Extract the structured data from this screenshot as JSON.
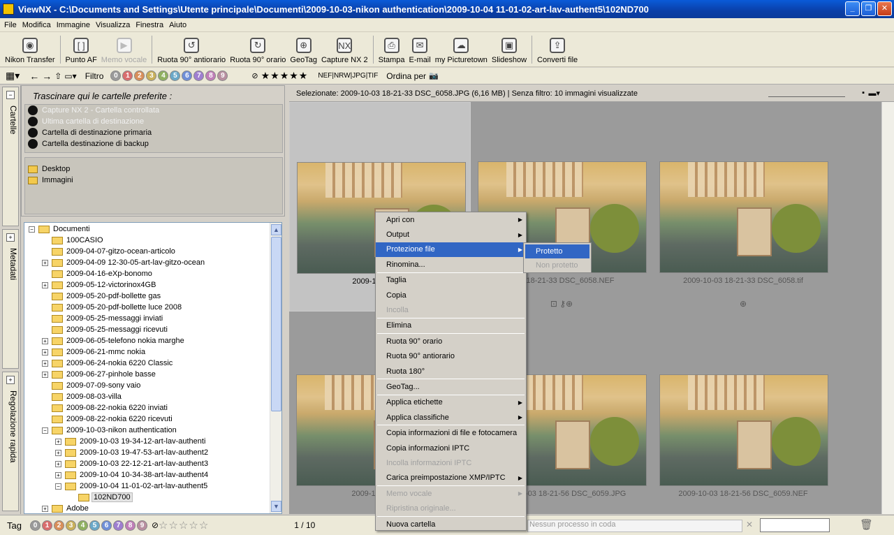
{
  "window": {
    "title": "ViewNX - C:\\Documents and Settings\\Utente principale\\Documenti\\2009-10-03-nikon authentication\\2009-10-04 11-01-02-art-lav-authent5\\102ND700"
  },
  "menu": [
    "File",
    "Modifica",
    "Immagine",
    "Visualizza",
    "Finestra",
    "Aiuto"
  ],
  "toolbar": [
    {
      "label": "Nikon Transfer",
      "icon": "camera-icon",
      "enabled": true
    },
    {
      "label": "Punto AF",
      "icon": "af-point-icon",
      "enabled": true
    },
    {
      "label": "Memo vocale",
      "icon": "voice-memo-icon",
      "enabled": false
    },
    {
      "label": "Ruota 90° antiorario",
      "icon": "rotate-ccw-icon",
      "enabled": true
    },
    {
      "label": "Ruota 90° orario",
      "icon": "rotate-cw-icon",
      "enabled": true
    },
    {
      "label": "GeoTag",
      "icon": "globe-icon",
      "enabled": true
    },
    {
      "label": "Capture NX 2",
      "icon": "capture-nx-icon",
      "enabled": true
    },
    {
      "label": "Stampa",
      "icon": "printer-icon",
      "enabled": true
    },
    {
      "label": "E-mail",
      "icon": "mail-icon",
      "enabled": true
    },
    {
      "label": "my Picturetown",
      "icon": "picturetown-icon",
      "enabled": true
    },
    {
      "label": "Slideshow",
      "icon": "slideshow-icon",
      "enabled": true
    },
    {
      "label": "Converti file",
      "icon": "convert-icon",
      "enabled": true
    }
  ],
  "filterbar": {
    "filter_label": "Filtro",
    "labels": [
      "0",
      "1",
      "2",
      "3",
      "4",
      "5",
      "6",
      "7",
      "8",
      "9"
    ],
    "label_colors": [
      "#9a9a9a",
      "#d96d6d",
      "#d98f5a",
      "#c9b05a",
      "#8fb060",
      "#6aa8c8",
      "#6f8fd8",
      "#9f7fd0",
      "#c07fb8",
      "#b88fa0"
    ],
    "stars": "★★★★★",
    "formats": "NEF|NRW|JPG|TIF",
    "sort_label": "Ordina per"
  },
  "side_tabs": [
    "Cartelle",
    "Metadati",
    "Regolazione rapida"
  ],
  "favorites": {
    "hint": "Trascinare qui le cartelle preferite :",
    "special": [
      {
        "label": "Capture NX 2 - Cartella controllata",
        "enabled": false
      },
      {
        "label": "Ultima cartella di destinazione",
        "enabled": false
      },
      {
        "label": "Cartella di destinazione primaria",
        "enabled": true
      },
      {
        "label": "Cartella destinazione di backup",
        "enabled": true
      }
    ],
    "folders": [
      "Desktop",
      "Immagini"
    ]
  },
  "tree": [
    {
      "label": "Documenti",
      "level": 0,
      "exp": "-"
    },
    {
      "label": "100CASIO",
      "level": 1,
      "exp": ""
    },
    {
      "label": "2009-04-07-gitzo-ocean-articolo",
      "level": 1,
      "exp": ""
    },
    {
      "label": "2009-04-09 12-30-05-art-lav-gitzo-ocean",
      "level": 1,
      "exp": "+"
    },
    {
      "label": "2009-04-16-eXp-bonomo",
      "level": 1,
      "exp": ""
    },
    {
      "label": "2009-05-12-victorinox4GB",
      "level": 1,
      "exp": "+"
    },
    {
      "label": "2009-05-20-pdf-bollette gas",
      "level": 1,
      "exp": ""
    },
    {
      "label": "2009-05-20-pdf-bollette luce 2008",
      "level": 1,
      "exp": ""
    },
    {
      "label": "2009-05-25-messaggi inviati",
      "level": 1,
      "exp": ""
    },
    {
      "label": "2009-05-25-messaggi ricevuti",
      "level": 1,
      "exp": ""
    },
    {
      "label": "2009-06-05-telefono nokia marghe",
      "level": 1,
      "exp": "+"
    },
    {
      "label": "2009-06-21-mmc nokia",
      "level": 1,
      "exp": "+"
    },
    {
      "label": "2009-06-24-nokia 6220 Classic",
      "level": 1,
      "exp": "+"
    },
    {
      "label": "2009-06-27-pinhole basse",
      "level": 1,
      "exp": "+"
    },
    {
      "label": "2009-07-09-sony vaio",
      "level": 1,
      "exp": ""
    },
    {
      "label": "2009-08-03-villa",
      "level": 1,
      "exp": ""
    },
    {
      "label": "2009-08-22-nokia 6220 inviati",
      "level": 1,
      "exp": ""
    },
    {
      "label": "2009-08-22-nokia 6220 ricevuti",
      "level": 1,
      "exp": ""
    },
    {
      "label": "2009-10-03-nikon authentication",
      "level": 1,
      "exp": "-"
    },
    {
      "label": "2009-10-03 19-34-12-art-lav-authenti",
      "level": 2,
      "exp": "+"
    },
    {
      "label": "2009-10-03 19-47-53-art-lav-authent2",
      "level": 2,
      "exp": "+"
    },
    {
      "label": "2009-10-03 22-12-21-art-lav-authent3",
      "level": 2,
      "exp": "+"
    },
    {
      "label": "2009-10-04 10-34-38-art-lav-authent4",
      "level": 2,
      "exp": "+"
    },
    {
      "label": "2009-10-04 11-01-02-art-lav-authent5",
      "level": 2,
      "exp": "-"
    },
    {
      "label": "102ND700",
      "level": 3,
      "exp": "",
      "selected": true
    },
    {
      "label": "Adobe",
      "level": 1,
      "exp": "+"
    }
  ],
  "main": {
    "header": "Selezionate: 2009-10-03 18-21-33 DSC_6058.JPG (6,16 MB) | Senza filtro: 10 immagini visualizzate",
    "thumbs": [
      {
        "caption": "2009-10-03 18-2",
        "selected": true
      },
      {
        "caption": "0-03 18-21-33 DSC_6058.NEF",
        "selected": false
      },
      {
        "caption": "2009-10-03 18-21-33 DSC_6058.tif",
        "selected": false
      },
      {
        "caption": "2009-10-03 18-2",
        "selected": false
      },
      {
        "caption": "2009-10-03 18-21-56 DSC_6059.JPG",
        "selected": false
      },
      {
        "caption": "2009-10-03 18-21-56 DSC_6059.NEF",
        "selected": false
      }
    ]
  },
  "context_menu": [
    {
      "label": "Apri con",
      "sub": true
    },
    {
      "label": "Output",
      "sub": true
    },
    {
      "label": "Protezione file",
      "sub": true,
      "highlighted": true
    },
    {
      "label": "Rinomina...",
      "sep_after": true
    },
    {
      "label": "Taglia"
    },
    {
      "label": "Copia"
    },
    {
      "label": "Incolla",
      "disabled": true,
      "sep_after": true
    },
    {
      "label": "Elimina",
      "sep_after": true
    },
    {
      "label": "Ruota 90° orario"
    },
    {
      "label": "Ruota 90° antiorario"
    },
    {
      "label": "Ruota 180°",
      "sep_after": true
    },
    {
      "label": "GeoTag...",
      "sep_after": true
    },
    {
      "label": "Applica etichette",
      "sub": true
    },
    {
      "label": "Applica classifiche",
      "sub": true,
      "sep_after": true
    },
    {
      "label": "Copia informazioni di file e fotocamera"
    },
    {
      "label": "Copia informazioni IPTC"
    },
    {
      "label": "Incolla informazioni IPTC",
      "disabled": true
    },
    {
      "label": "Carica preimpostazione XMP/IPTC",
      "sub": true,
      "sep_after": true
    },
    {
      "label": "Memo vocale",
      "sub": true,
      "disabled": true
    },
    {
      "label": "Ripristina originale...",
      "disabled": true,
      "sep_after": true
    },
    {
      "label": "Nuova cartella"
    }
  ],
  "submenu": [
    {
      "label": "Protetto",
      "highlighted": true
    },
    {
      "label": "Non protetto",
      "disabled": true
    }
  ],
  "statusbar": {
    "tag_label": "Tag",
    "page": "1 / 10",
    "queue": "Nessun processo in coda"
  }
}
